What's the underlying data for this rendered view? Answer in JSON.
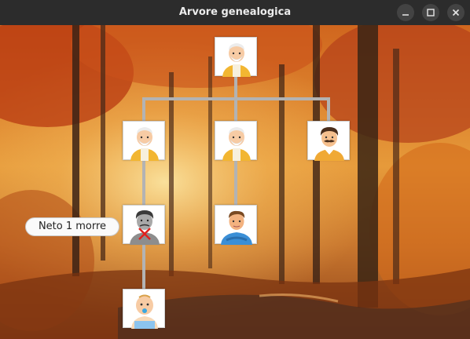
{
  "window": {
    "title": "Arvore genealogica"
  },
  "titlebar_buttons": [
    "minimize-icon",
    "maximize-icon",
    "close-icon"
  ],
  "tooltip": {
    "text": "Neto 1 morre"
  },
  "tree": {
    "connector_color": "#b3b3b3",
    "nodes": [
      {
        "id": "root",
        "icon": "grandfather-avatar-icon"
      },
      {
        "id": "child-1",
        "icon": "elderly-man-avatar-icon"
      },
      {
        "id": "child-2",
        "icon": "elderly-man-avatar-icon"
      },
      {
        "id": "child-3",
        "icon": "mustached-man-avatar-icon"
      },
      {
        "id": "grandchild-1",
        "icon": "deceased-man-avatar-icon",
        "status": "deceased"
      },
      {
        "id": "grandchild-2",
        "icon": "young-man-avatar-icon"
      },
      {
        "id": "great-grandchild-1",
        "icon": "baby-avatar-icon"
      }
    ]
  },
  "colors": {
    "titlebar": "#2c2c2c",
    "background_theme": "autumn forest",
    "deceased_mark": "#e0201c"
  }
}
